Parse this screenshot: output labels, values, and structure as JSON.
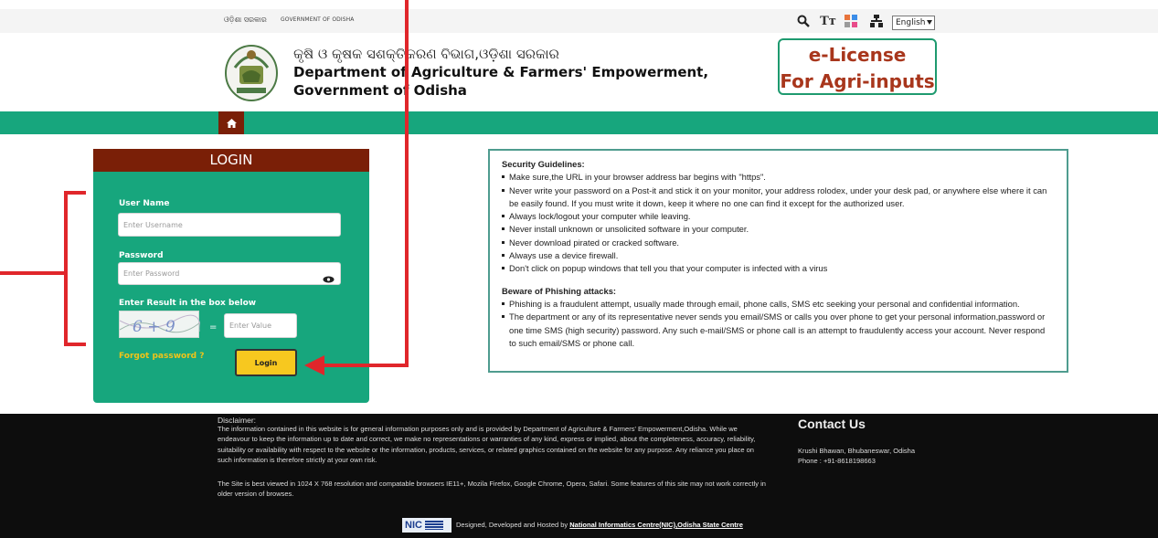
{
  "topbar": {
    "gov_odia": "ଓଡ଼ିଶା ସରକାର",
    "gov_en": "GOVERNMENT OF ODISHA",
    "textsize_label": "Tт",
    "language": "English"
  },
  "header": {
    "dept_odia": "କୃଷି ଓ କୃଷକ ସଶକ୍ତିକରଣ ବିଭାଗ,ଓଡ଼ିଶା ସରକାର",
    "dept_en": "Department of Agriculture & Farmers' Empowerment,",
    "gov_en": "Government of Odisha",
    "elicense_line1": "e-License",
    "elicense_line2": "For Agri-inputs"
  },
  "login": {
    "title": "LOGIN",
    "username_label": "User Name",
    "username_placeholder": "Enter Username",
    "password_label": "Password",
    "password_placeholder": "Enter Password",
    "captcha_label": "Enter Result in the box below",
    "captcha_text": "6 + 9",
    "equals": "=",
    "captcha_placeholder": "Enter Value",
    "forgot": "Forgot password ?",
    "login_button": "Login"
  },
  "guidelines": {
    "security_title": "Security Guidelines:",
    "security_items": [
      "Make sure,the URL in your browser address bar begins with \"https\".",
      "Never write your password on a Post-it and stick it on your monitor, your address rolodex, under your desk pad, or anywhere else where it can be easily found. If you must write it down, keep it where no one can find it except for the authorized user.",
      "Always lock/logout your computer while leaving.",
      "Never install unknown or unsolicited software in your computer.",
      "Never download pirated or cracked software.",
      "Always use a device firewall.",
      "Don't click on popup windows that tell you that your computer is infected with a virus"
    ],
    "phishing_title": "Beware of Phishing attacks:",
    "phishing_items": [
      "Phishing is a fraudulent attempt, usually made through email, phone calls, SMS etc seeking your personal and confidential information.",
      "The department or any of its representative never sends you email/SMS or calls you over phone to get your personal information,password or one time SMS (high security) password. Any such e-mail/SMS or phone call is an attempt to fraudulently access your account. Never respond to such email/SMS or phone call."
    ]
  },
  "footer": {
    "disclaimer_title": "Disclaimer:",
    "disclaimer_text": "The information contained in this website is for general information purposes only and is provided by Department of Agriculture & Farmers' Empowerment,Odisha. While we endeavour to keep the information up to date and correct, we make no representations or warranties of any kind, express or implied, about the completeness, accuracy, reliability, suitability or availability with respect to the website or the information, products, services, or related graphics contained on the website for any purpose. Any reliance you place on such information is therefore strictly at your own risk.",
    "browser_text": "The Site is best viewed in 1024 X 768 resolution and compatable browsers IE11+, Mozila Firefox, Google Chrome, Opera, Safari. Some features of this site may not work correctly in older version of browses.",
    "contact_title": "Contact Us",
    "address": "Krushi Bhawan, Bhubaneswar, Odisha",
    "phone": "Phone : +91-8618198663",
    "nic_logo": "NIC",
    "credit_prefix": "Designed, Developed and Hosted by ",
    "credit_link": "National Informatics Centre(NIC),Odisha State Centre"
  },
  "colors": {
    "green": "#17a67d",
    "maroon": "#7a1f07",
    "button_yellow": "#f7c81f",
    "annotation_red": "#e0262b"
  }
}
